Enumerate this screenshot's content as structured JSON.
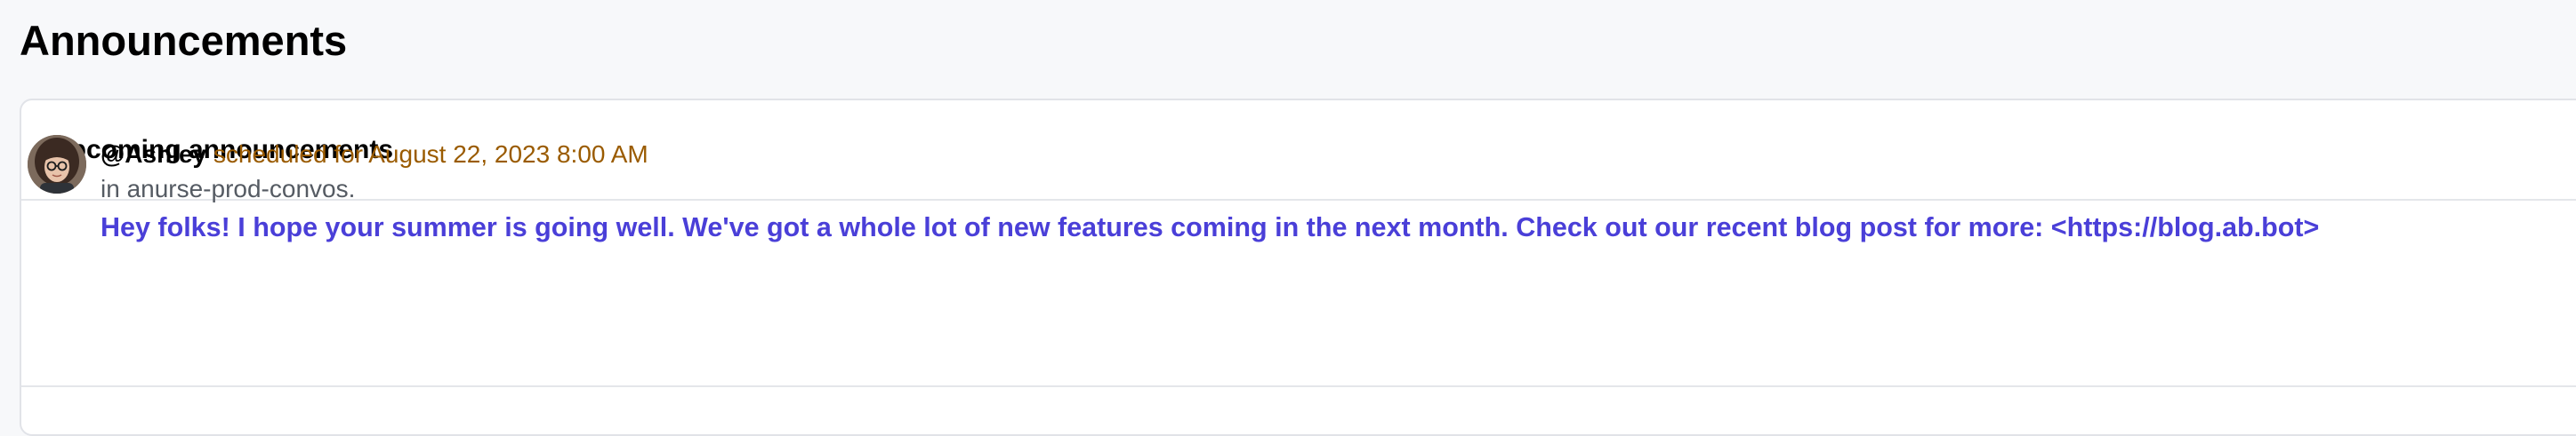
{
  "page": {
    "title": "Announcements"
  },
  "upcoming": {
    "title": "Upcoming announcements",
    "items": [
      {
        "user": "@Ashley",
        "schedule_text": "scheduled for August 22, 2023 8:00 AM",
        "channel_text": "in anurse-prod-convos.",
        "message": "Hey folks! I hope your summer is going well. We've got a whole lot of new features coming in the next month. Check out our recent blog post for more: <https://blog.ab.bot>"
      }
    ]
  },
  "colors": {
    "schedule": "#9a5b00",
    "message_link": "#4a3fd8",
    "muted": "#555b63"
  }
}
